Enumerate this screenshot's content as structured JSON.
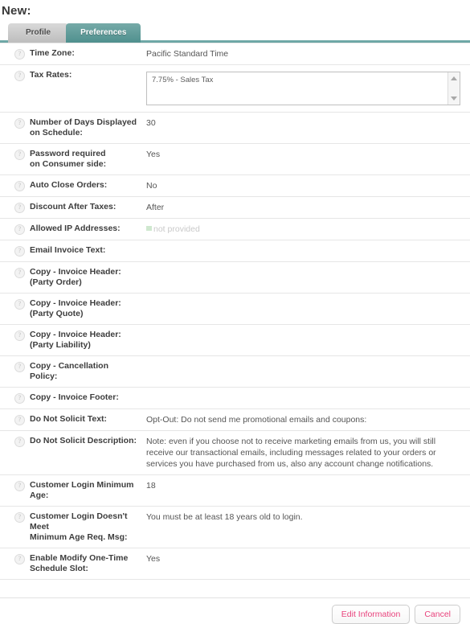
{
  "page": {
    "title": "New:"
  },
  "tabs": [
    {
      "label": "Profile",
      "active": false
    },
    {
      "label": "Preferences",
      "active": true
    }
  ],
  "icons": {
    "help": "?",
    "scroll_up": "scroll-up-arrow-icon",
    "scroll_down": "scroll-down-arrow-icon"
  },
  "rows": [
    {
      "label": "Time Zone:",
      "value": "Pacific Standard Time",
      "type": "text"
    },
    {
      "label": "Tax Rates:",
      "value": "7.75% - Sales Tax",
      "type": "listbox"
    },
    {
      "label": "Number of Days Displayed\non Schedule:",
      "value": "30",
      "type": "text"
    },
    {
      "label": "Password required\non Consumer side:",
      "value": "Yes",
      "type": "text"
    },
    {
      "label": "Auto Close Orders:",
      "value": "No",
      "type": "text"
    },
    {
      "label": "Discount After Taxes:",
      "value": "After",
      "type": "text"
    },
    {
      "label": "Allowed IP Addresses:",
      "value": "not provided",
      "type": "empty"
    },
    {
      "label": "Email Invoice Text:",
      "value": "",
      "type": "text"
    },
    {
      "label": "Copy - Invoice Header:\n(Party Order)",
      "value": "",
      "type": "text"
    },
    {
      "label": "Copy - Invoice Header:\n(Party Quote)",
      "value": "",
      "type": "text"
    },
    {
      "label": "Copy - Invoice Header:\n(Party Liability)",
      "value": "",
      "type": "text"
    },
    {
      "label": "Copy - Cancellation Policy:",
      "value": "",
      "type": "text"
    },
    {
      "label": "Copy - Invoice Footer:",
      "value": "",
      "type": "text"
    },
    {
      "label": "Do Not Solicit Text:",
      "value": "Opt-Out: Do not send me promotional emails and coupons:",
      "type": "text"
    },
    {
      "label": "Do Not Solicit Description:",
      "value": "Note: even if you choose not to receive marketing emails from us, you will still receive our transactional emails, including messages related to your orders or services you have purchased from us, also any account change notifications.",
      "type": "text"
    },
    {
      "label": "Customer Login Minimum Age:",
      "value": "18",
      "type": "text"
    },
    {
      "label": "Customer Login Doesn't Meet\nMinimum Age Req. Msg:",
      "value": "You must be at least 18 years old to login.",
      "type": "text"
    },
    {
      "label": "Enable Modify One-Time\nSchedule Slot:",
      "value": "Yes",
      "type": "text"
    }
  ],
  "footer": {
    "edit_label": "Edit Information",
    "cancel_label": "Cancel"
  },
  "colors": {
    "active_tab": "#5f9d9c",
    "inactive_tab": "#cccccc",
    "button_text": "#e8427c",
    "row_border": "#e6e6e6"
  }
}
